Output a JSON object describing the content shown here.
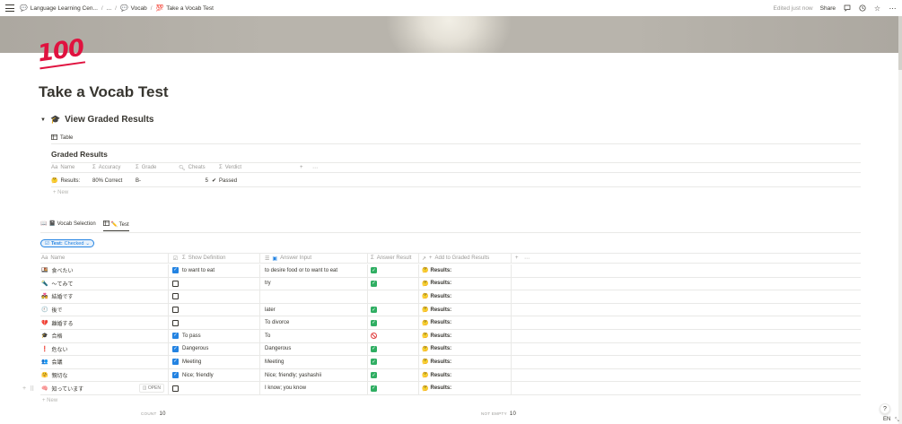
{
  "topbar": {
    "breadcrumbs": [
      {
        "icon": "💬",
        "label": "Language Learning Cen..."
      },
      {
        "icon": "",
        "label": "..."
      },
      {
        "icon": "💬",
        "label": "Vocab"
      },
      {
        "icon": "💯",
        "label": "Take a Vocab Test"
      }
    ],
    "edited": "Edited just now",
    "share": "Share"
  },
  "page": {
    "icon_text": "100",
    "title": "Take a Vocab Test"
  },
  "toggle": {
    "label": "View Graded Results",
    "icon": "🎓"
  },
  "graded_view": {
    "tab_label": "Table",
    "title": "Graded Results",
    "columns": [
      "Name",
      "Accuracy",
      "Grade",
      "Cheats",
      "Verdict"
    ],
    "column_prefixes": [
      "Aa",
      "Σ",
      "Σ",
      "🔍",
      "Σ"
    ],
    "row": {
      "name": "Results:",
      "accuracy": "80% Correct",
      "grade": "B-",
      "cheats": "5",
      "verdict": "Passed"
    },
    "new_label": "New"
  },
  "test_view": {
    "tabs": [
      {
        "label": "📓 Vocab Selection",
        "active": false
      },
      {
        "label": "✏️ Test",
        "active": true
      }
    ],
    "filter": {
      "label": "Test:",
      "value": "Checked"
    },
    "columns": {
      "name": "Name",
      "show_definition": "Show Definition",
      "answer_input": "Answer Input",
      "answer_result": "Answer Result",
      "add_to_graded": "Add to Graded Results"
    },
    "rows": [
      {
        "icon": "🍱",
        "name": "食べたい",
        "checked": true,
        "definition": "to want to eat",
        "input": "to desire food or to want to eat",
        "result": "ok",
        "graded": "Results:"
      },
      {
        "icon": "🔦",
        "name": "〜てみて",
        "checked": false,
        "definition": "",
        "input": "try",
        "result": "ok",
        "graded": "Results:"
      },
      {
        "icon": "💑",
        "name": "結婚です",
        "checked": false,
        "definition": "",
        "input": "",
        "result": "none",
        "graded": "Results:"
      },
      {
        "icon": "🕘",
        "name": "後で",
        "checked": false,
        "definition": "",
        "input": "later",
        "result": "ok",
        "graded": "Results:"
      },
      {
        "icon": "💔",
        "name": "離婚する",
        "checked": false,
        "definition": "",
        "input": "To divorce",
        "result": "ok",
        "graded": "Results:"
      },
      {
        "icon": "🎓",
        "name": "合格",
        "checked": true,
        "definition": "To pass",
        "input": "To",
        "result": "no",
        "graded": "Results:"
      },
      {
        "icon": "❗",
        "name": "危ない",
        "checked": true,
        "definition": "Dangerous",
        "input": "Dangerous",
        "result": "ok",
        "graded": "Results:"
      },
      {
        "icon": "👥",
        "name": "会議",
        "checked": true,
        "definition": "Meeting",
        "input": "Meeting",
        "result": "ok",
        "graded": "Results:"
      },
      {
        "icon": "🤗",
        "name": "親切な",
        "checked": true,
        "definition": "Nice; friendly",
        "input": "Nice; friendly; yashashii",
        "result": "ok",
        "graded": "Results:"
      },
      {
        "icon": "🧠",
        "name": "知っています",
        "checked": false,
        "definition": "",
        "input": "I know; you know",
        "result": "ok",
        "graded": "Results:",
        "open": "OPEN"
      }
    ],
    "new_label": "New",
    "footer": {
      "count_label": "COUNT",
      "count_value": "10",
      "not_empty_label": "NOT EMPTY",
      "not_empty_value": "10"
    }
  },
  "help": "?",
  "lang": "EN",
  "colors": {
    "accent": "#2383e2",
    "ok": "#2fae62",
    "fail": "#e03e3e",
    "text": "#37352f",
    "muted": "#9b9a97"
  }
}
